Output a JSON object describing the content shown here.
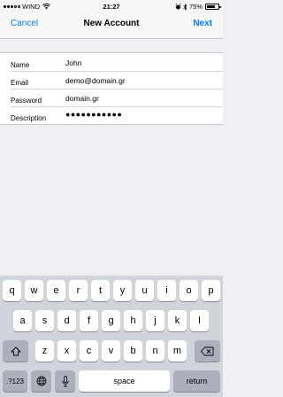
{
  "status_bar": {
    "carrier": "WIND",
    "time": "21:27",
    "battery": "75%",
    "battery_level": 0.75,
    "icons": [
      "signal-icon",
      "wifi-icon",
      "alarm-icon",
      "bluetooth-icon",
      "battery-icon"
    ]
  },
  "nav": {
    "cancel": "Cancel",
    "title": "New Account",
    "next": "Next"
  },
  "form": {
    "name_label": "Name",
    "name_value": "John",
    "email_label": "Email",
    "email_value": "demo@domain.gr",
    "password_label": "Password",
    "password_value": "domain.gr",
    "description_label": "Description",
    "description_value": "●●●●●●●●●●●"
  },
  "keyboard": {
    "row1": [
      "q",
      "w",
      "e",
      "r",
      "t",
      "y",
      "u",
      "i",
      "o",
      "p"
    ],
    "row2": [
      "a",
      "s",
      "d",
      "f",
      "g",
      "h",
      "j",
      "k",
      "l"
    ],
    "row3": [
      "z",
      "x",
      "c",
      "v",
      "b",
      "n",
      "m"
    ],
    "numbers_key": ".?123",
    "space_key": "space",
    "return_key": "return",
    "icons": [
      "shift-icon",
      "delete-icon",
      "globe-icon",
      "microphone-icon"
    ]
  },
  "colors": {
    "accent": "#007aff",
    "background": "#efeff4",
    "keyboard_bg": "#d1d5db"
  }
}
